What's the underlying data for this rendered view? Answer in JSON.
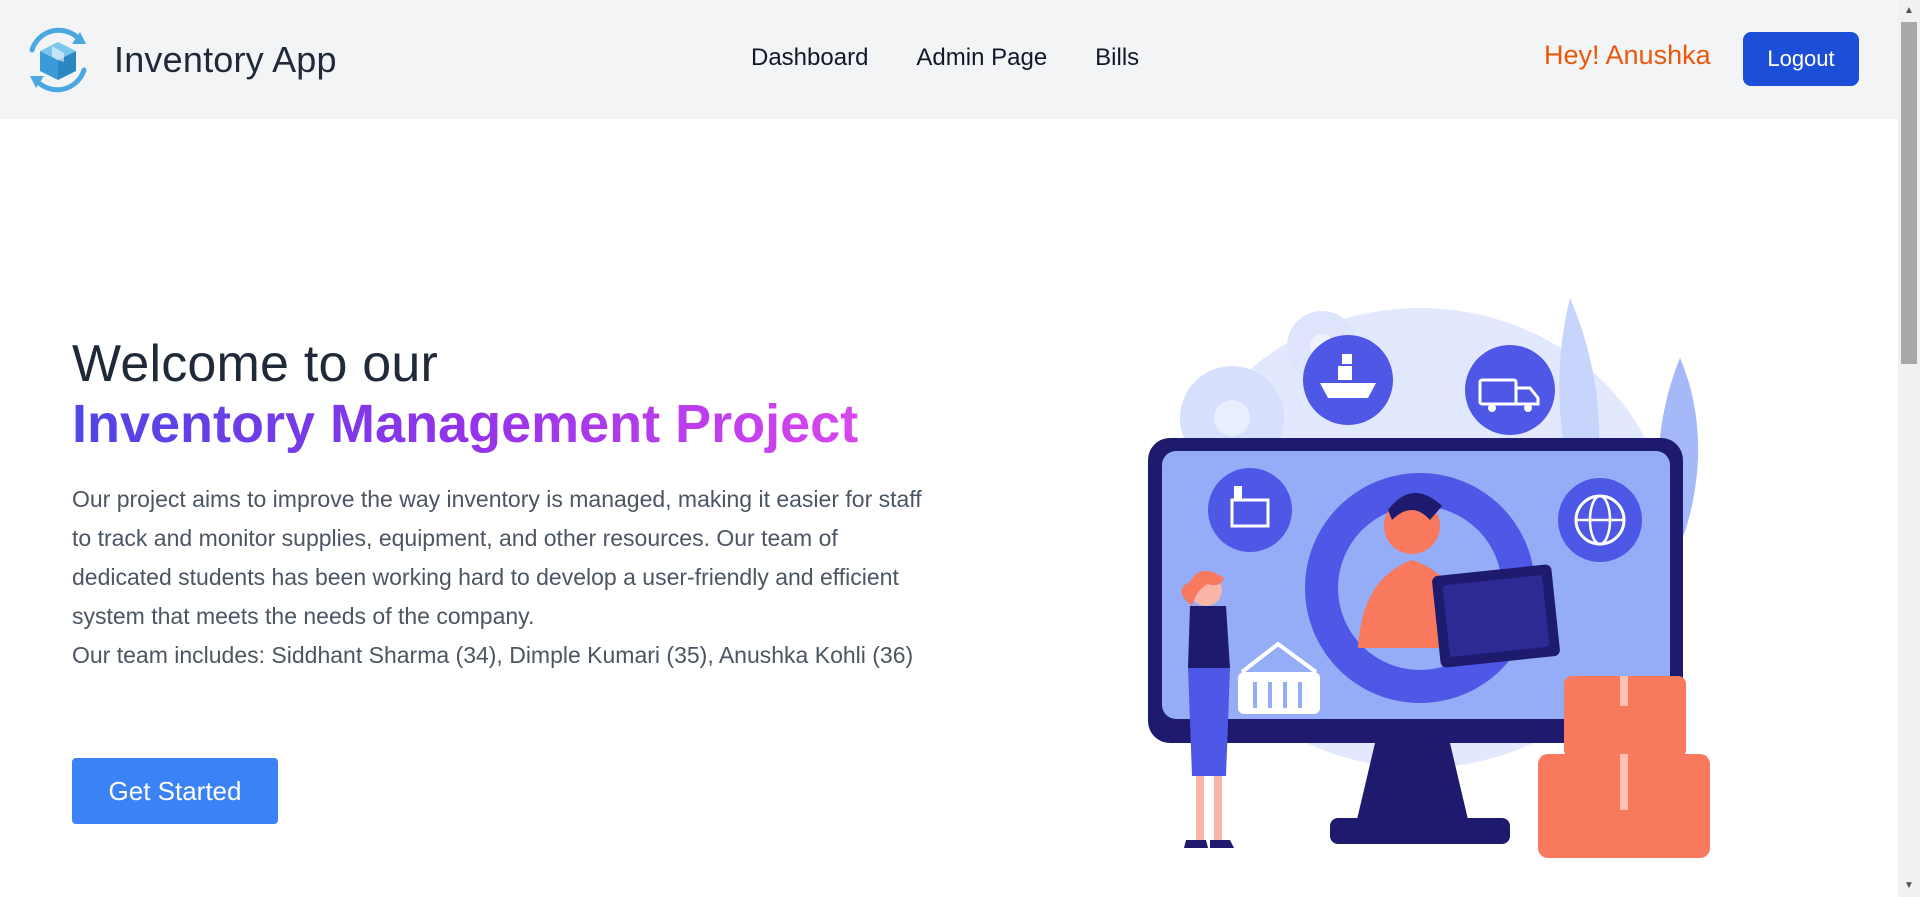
{
  "header": {
    "brand": "Inventory App",
    "nav": [
      "Dashboard",
      "Admin Page",
      "Bills"
    ],
    "greeting": "Hey! Anushka",
    "logout_label": "Logout"
  },
  "hero": {
    "pre_title": "Welcome to our",
    "title": "Inventory Management Project",
    "description": "Our project aims to improve the way inventory is managed, making it easier for staff to track and monitor supplies, equipment, and other resources. Our team of dedicated students has been working hard to develop a user-friendly and efficient system that meets the needs of the company.",
    "team": "Our team includes: Siddhant Sharma (34), Dimple Kumari (35), Anushka Kohli (36)",
    "cta_label": "Get Started"
  },
  "colors": {
    "header_bg": "#f3f4f6",
    "greeting": "#ea580c",
    "logout_bg": "#1d4ed8",
    "cta_bg": "#3b82f6",
    "title_gradient_start": "#4f46e5",
    "title_gradient_end": "#d946ef"
  }
}
